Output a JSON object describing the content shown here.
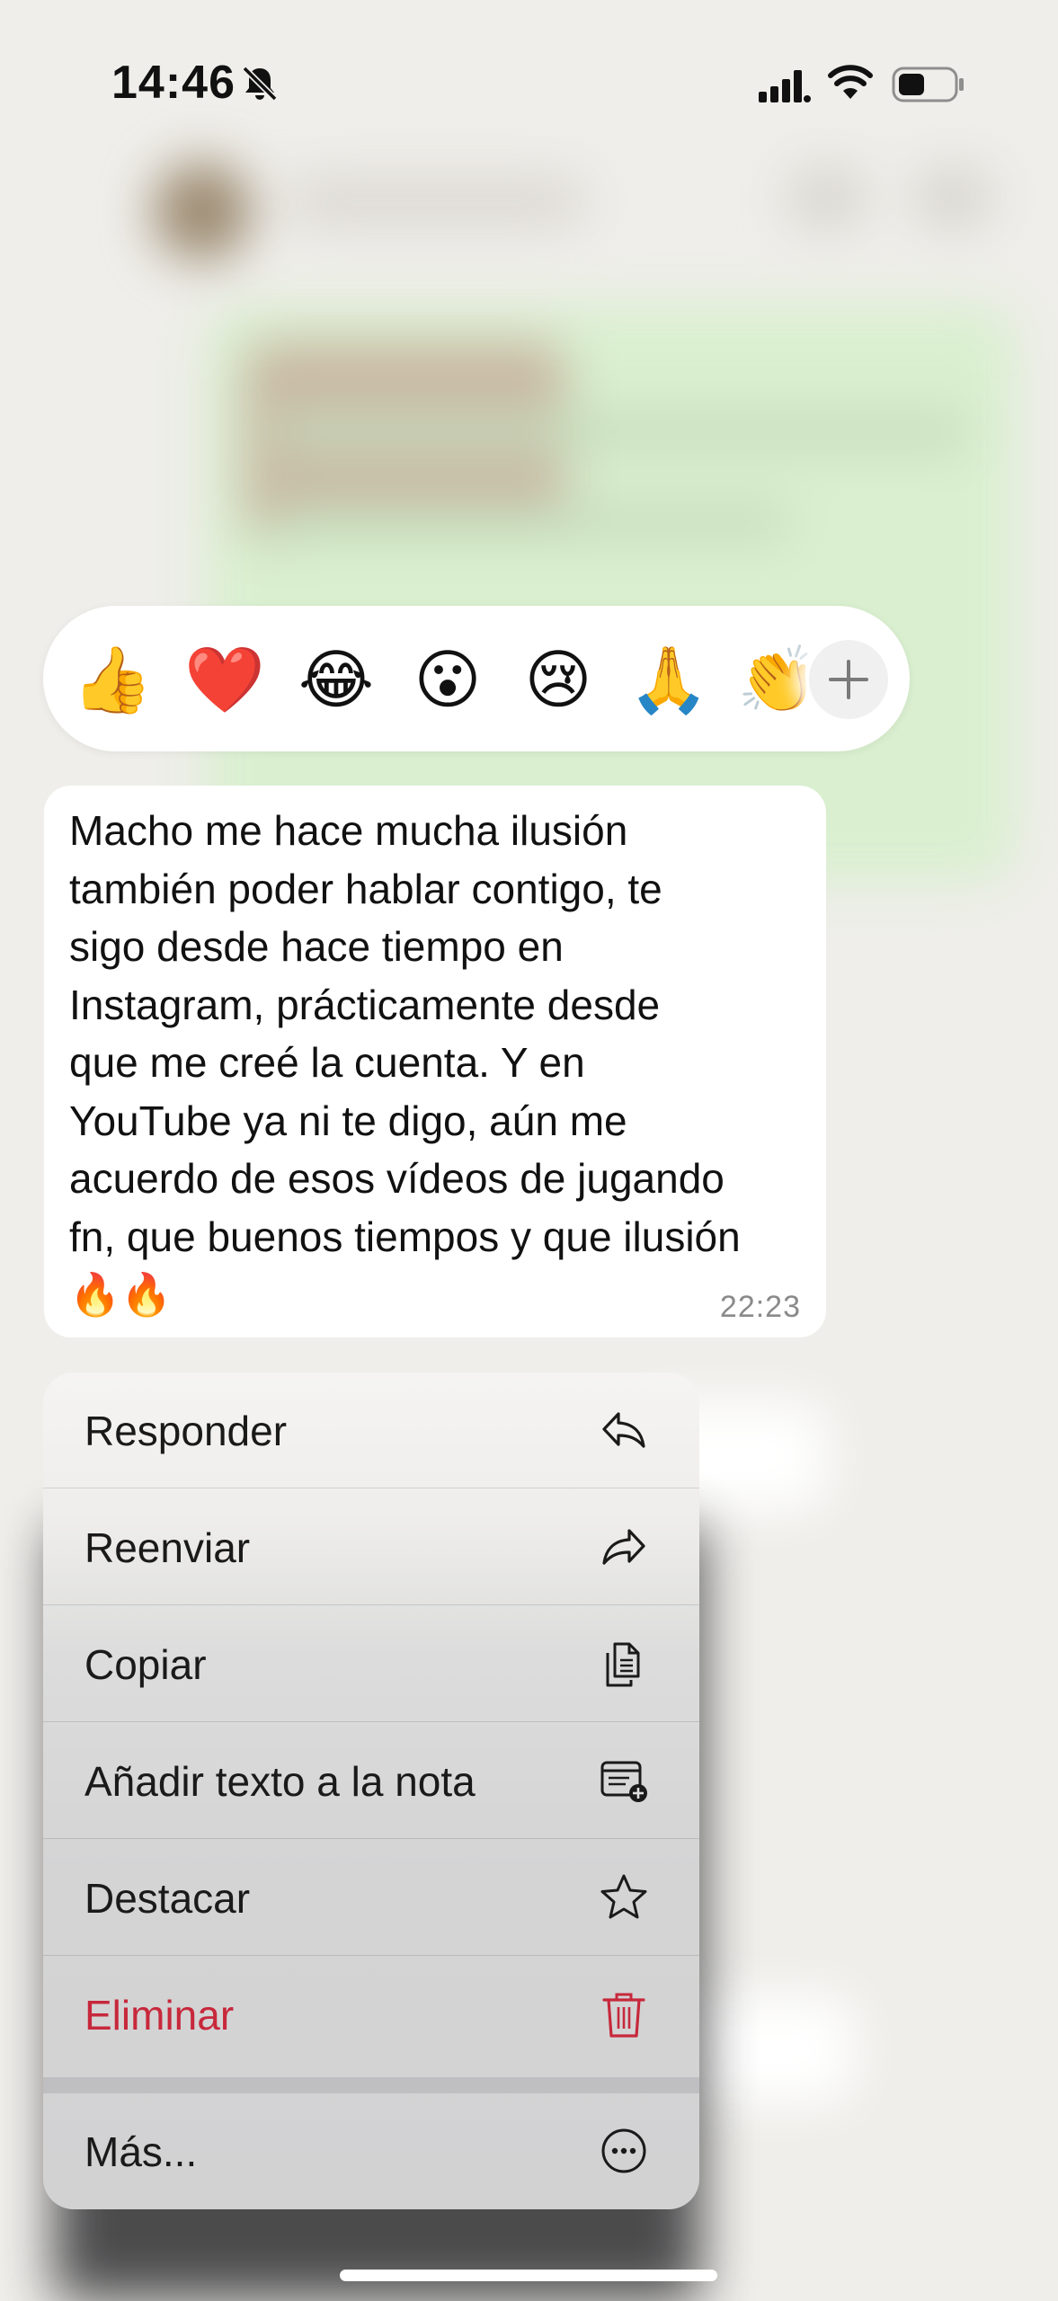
{
  "status_bar": {
    "time": "14:46",
    "bell_icon": "bell-slash-icon",
    "signal_icon": "cellular-signal-icon",
    "wifi_icon": "wifi-icon",
    "battery_icon": "battery-icon"
  },
  "reactions": {
    "items": [
      {
        "emoji": "👍",
        "name": "thumbs-up"
      },
      {
        "emoji": "❤️",
        "name": "heart"
      },
      {
        "emoji": "😂",
        "name": "tears-of-joy"
      },
      {
        "emoji": "😮",
        "name": "surprised"
      },
      {
        "emoji": "😢",
        "name": "crying"
      },
      {
        "emoji": "🙏",
        "name": "folded-hands"
      },
      {
        "emoji": "👏",
        "name": "clapping"
      }
    ],
    "more_icon": "plus-icon"
  },
  "message": {
    "text": "Macho me hace mucha ilusión\ntambién poder hablar contigo, te\nsigo desde hace tiempo en\nInstagram, prácticamente desde\nque me creé la cuenta. Y en\nYouTube ya ni te digo, aún me\nacuerdo de esos vídeos de jugando\nfn, que buenos tiempos y que ilusión\n🔥🔥",
    "time": "22:23"
  },
  "menu": {
    "items": [
      {
        "label": "Responder",
        "icon": "reply-icon"
      },
      {
        "label": "Reenviar",
        "icon": "forward-icon"
      },
      {
        "label": "Copiar",
        "icon": "copy-icon"
      },
      {
        "label": "Añadir texto a la nota",
        "icon": "add-note-icon"
      },
      {
        "label": "Destacar",
        "icon": "star-icon"
      },
      {
        "label": "Eliminar",
        "icon": "trash-icon"
      },
      {
        "label": "Más...",
        "icon": "more-icon"
      }
    ]
  },
  "colors": {
    "background": "#efeeea",
    "bubble": "#ffffff",
    "danger": "#c7283b",
    "chat_green": "#d9efcf"
  }
}
